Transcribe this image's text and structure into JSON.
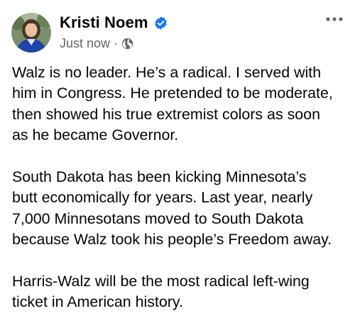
{
  "post": {
    "author": "Kristi Noem",
    "verified_icon": "verified-badge-icon",
    "timestamp": "Just now",
    "separator": "·",
    "audience_icon": "globe-icon",
    "more_icon": "more-options-icon",
    "paragraphs": [
      "Walz is no leader. He’s a radical. I served with\nhim in Congress. He pretended to be moderate,\nthen showed his true extremist colors as soon\nas he became Governor.",
      "South Dakota has been kicking Minnesota’s\nbutt economically for years. Last year, nearly\n7,000 Minnesotans moved to South Dakota\nbecause Walz took his people’s Freedom away.",
      "Harris-Walz will be the most radical left-wing\nticket in American history."
    ]
  },
  "colors": {
    "text": "#050505",
    "secondary": "#65676b",
    "verified": "#1877f2",
    "background": "#ffffff"
  }
}
